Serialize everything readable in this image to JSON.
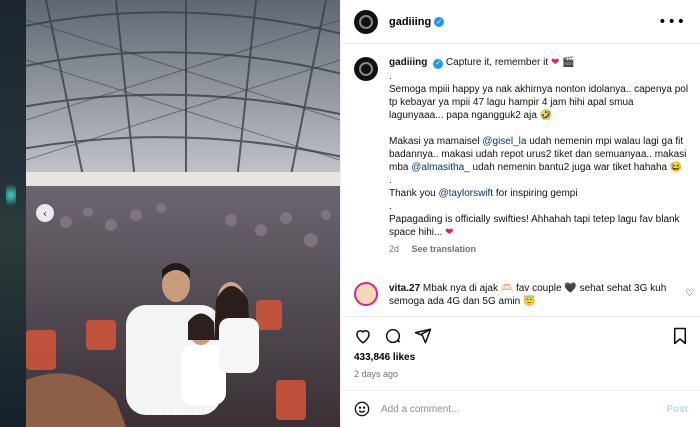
{
  "post": {
    "username": "gadiiing",
    "verified": true
  },
  "caption": {
    "username": "gadiiing",
    "first_line": "Capture it, remember it",
    "first_line_emoji": "❤",
    "first_line_emoji2": "🎬",
    "dot": ".",
    "para1": "Semoga mpiii happy ya nak akhirnya nonton idolanya.. capenya pol tp kebayar ya mpii 47 lagu hampir 4 jam hihi apal smua lagunyaaa... papa ngangguk2 aja 🤣",
    "para2_pre": "Makasi ya mamaisel ",
    "para2_mention1": "@gisel_la",
    "para2_mid": " udah nemenin mpi walau lagi ga fit badannya.. makasi udah repot urus2 tiket dan semuanyaa.. makasi mba ",
    "para2_mention2": "@almasitha_",
    "para2_post": " udah nemenin bantu2 juga war tiket hahaha 😆",
    "para3_pre": "Thank you ",
    "para3_mention": "@taylorswift",
    "para3_post": " for inspiring gempi",
    "para4": "Papagading is officially swifties! Ahhahah tapi tetep lagu fav blank space hihi...",
    "para4_emoji": "❤",
    "time": "2d",
    "see_translation": "See translation"
  },
  "comment": {
    "username": "vita.27",
    "text": "Mbak nya di ajak 🫶🏻 fav couple 🖤 sehat sehat 3G kuh semoga ada 4G dan 5G amin 😇"
  },
  "stats": {
    "likes": "433,846 likes",
    "ago": "2 days ago"
  },
  "composer": {
    "placeholder": "Add a comment...",
    "post_label": "Post"
  },
  "carousel": {
    "slide_count": 9,
    "active_index": 5
  },
  "icons": {
    "verified": "verified-badge-icon",
    "more": "more-options-icon",
    "like": "heart-icon",
    "comment": "comment-icon",
    "share": "share-icon",
    "save": "bookmark-icon",
    "emoji": "emoji-icon",
    "prev": "chevron-left-icon",
    "next": "chevron-right-icon"
  },
  "colors": {
    "verified": "#1d9bf0",
    "mention": "#00376b",
    "post_button": "#b3dbff",
    "heart": "#e0245e"
  }
}
